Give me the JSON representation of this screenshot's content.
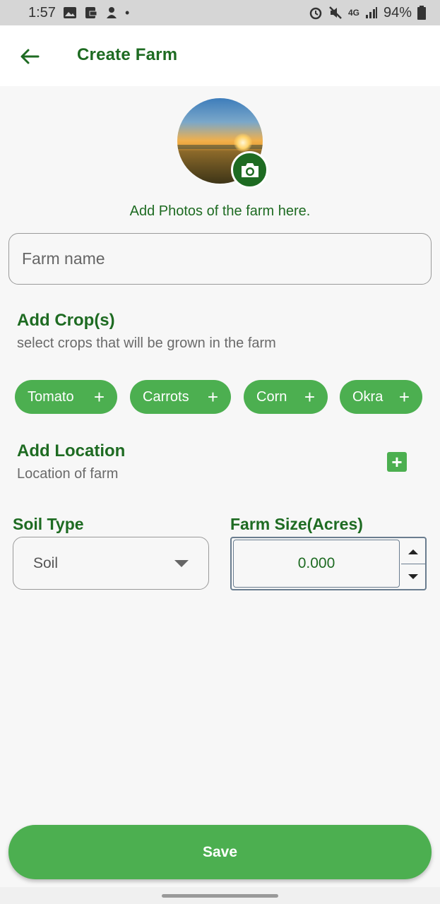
{
  "status_bar": {
    "time": "1:57",
    "network": "4G",
    "battery": "94%",
    "icons": [
      "image-icon",
      "download-icon",
      "notification-icon",
      "dot-icon",
      "alarm-icon",
      "mute-icon",
      "network-icon",
      "signal-icon",
      "battery-icon"
    ]
  },
  "app_bar": {
    "title": "Create Farm",
    "back_icon": "arrow-left-icon"
  },
  "photo": {
    "caption": "Add Photos of the farm here.",
    "camera_icon": "camera-icon"
  },
  "farm_name": {
    "placeholder": "Farm name",
    "value": ""
  },
  "crops": {
    "title": "Add Crop(s)",
    "subtitle": "select crops that will be grown in the farm",
    "items": [
      {
        "label": "Tomato",
        "icon": "+"
      },
      {
        "label": "Carrots",
        "icon": "+"
      },
      {
        "label": "Corn",
        "icon": "+"
      },
      {
        "label": "Okra",
        "icon": "+"
      }
    ]
  },
  "location": {
    "title": "Add Location",
    "subtitle": "Location of farm",
    "add_icon": "+"
  },
  "soil": {
    "label": "Soil Type",
    "selected": "Soil"
  },
  "farm_size": {
    "label": "Farm Size(Acres)",
    "value": "0.000"
  },
  "actions": {
    "save_label": "Save"
  },
  "colors": {
    "primary_green": "#4caf50",
    "dark_green": "#1e6b22",
    "background": "#f7f7f7"
  }
}
